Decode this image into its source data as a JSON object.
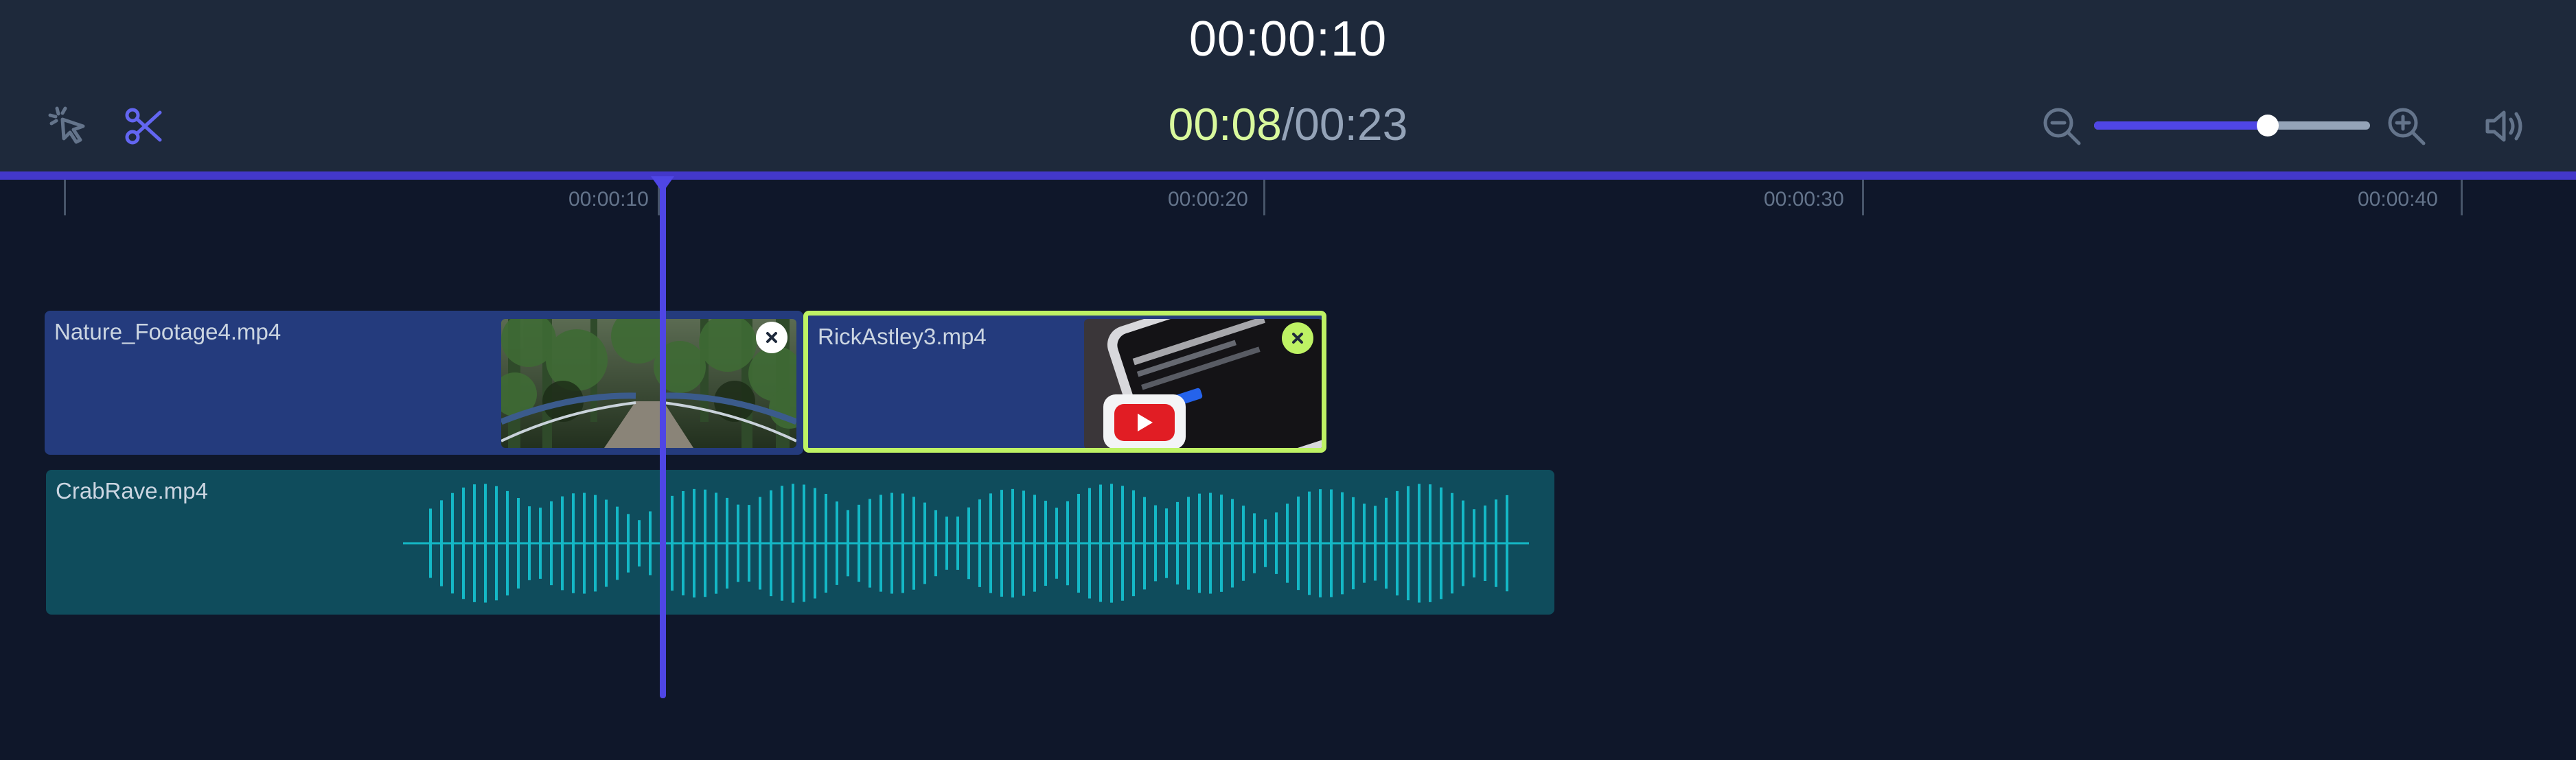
{
  "header": {
    "title": "00:00:10"
  },
  "toolbar": {
    "select_tool_icon": "cursor-click-icon",
    "cut_tool_icon": "scissors-icon",
    "current_time": "00:08",
    "separator": "/",
    "total_time": "00:23",
    "zoom_out_icon": "zoom-out-icon",
    "zoom_in_icon": "zoom-in-icon",
    "volume_icon": "volume-icon",
    "zoom_level": 0.63,
    "colors": {
      "current_time": "#d9f99d",
      "accent": "#4f46e5",
      "cut_tool": "#6366f1"
    }
  },
  "ruler": {
    "ticks": [
      "00:00:10",
      "00:00:20",
      "00:00:30",
      "00:00:40"
    ]
  },
  "tracks": {
    "video": [
      {
        "name": "Nature_Footage4.mp4",
        "thumbnail": "forest-bridge-image",
        "selected": false
      },
      {
        "name": "RickAstley3.mp4",
        "thumbnail": "youtube-phone-image",
        "selected": true
      }
    ],
    "audio": [
      {
        "name": "CrabRave.mp4",
        "waveform": "audio-waveform"
      }
    ]
  },
  "colors": {
    "background": "#0f172a",
    "panel": "#1e293b",
    "video_clip": "#243b7d",
    "audio_clip": "#0f4c5c",
    "waveform": "#14b8c6",
    "selected_border": "#bef264"
  }
}
